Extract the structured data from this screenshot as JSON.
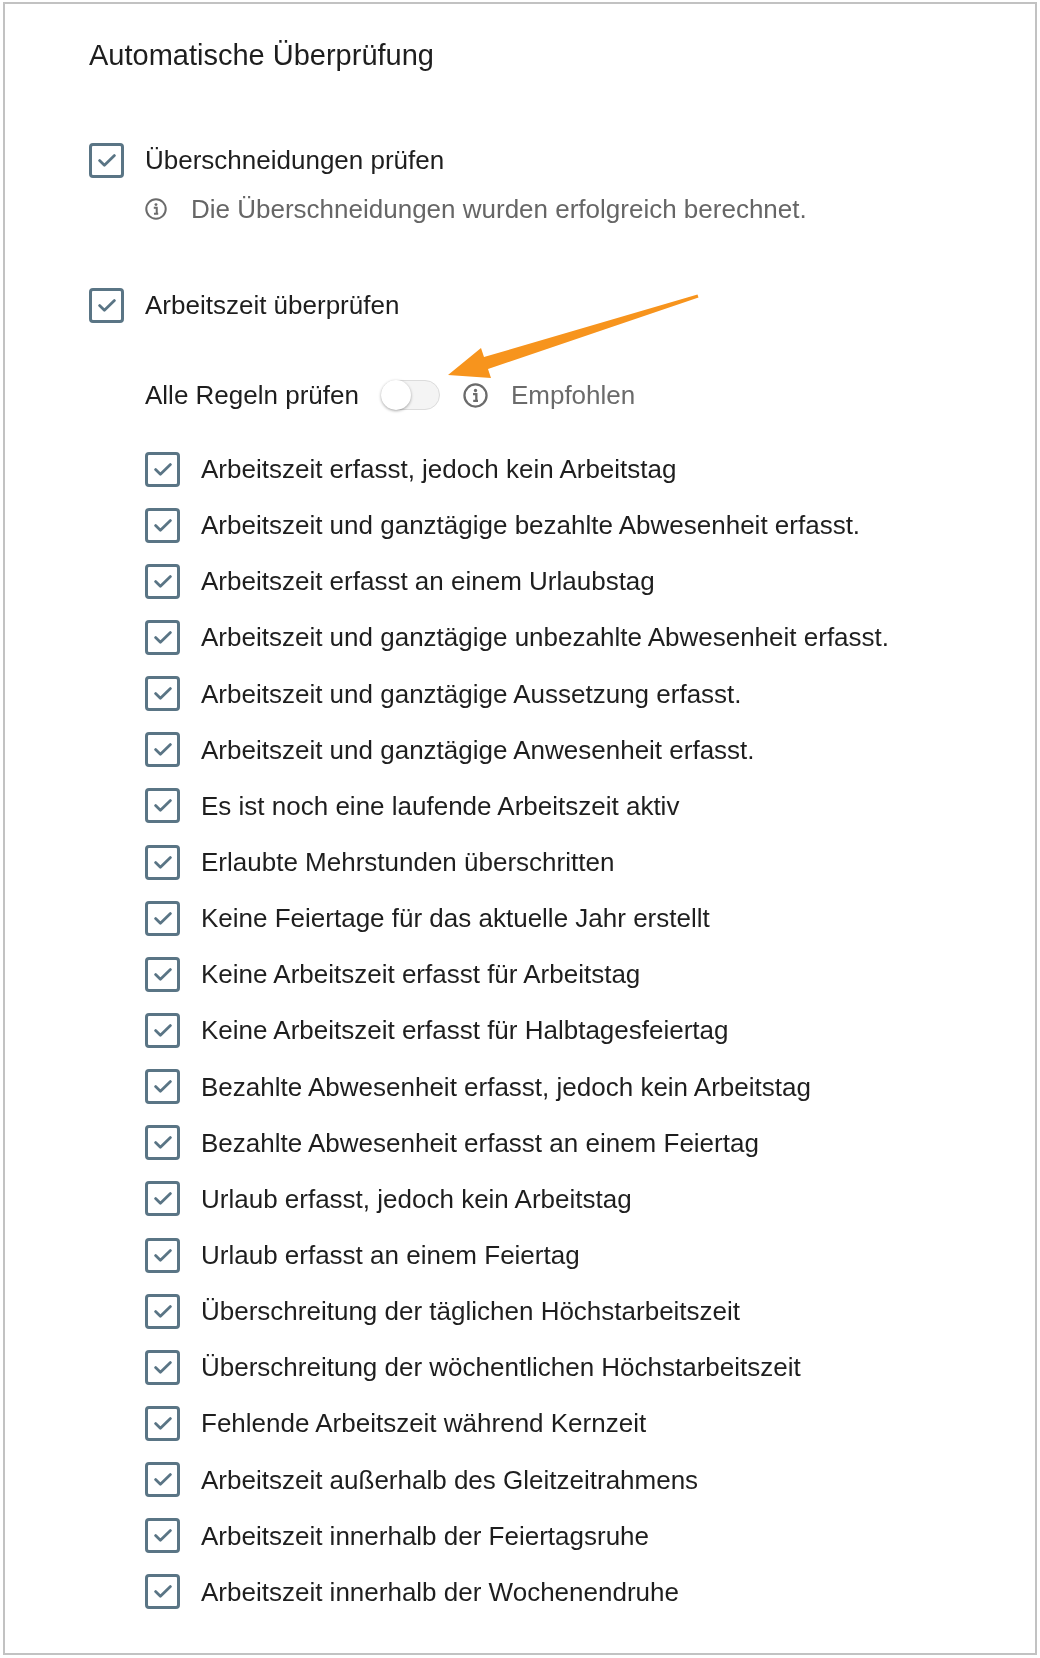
{
  "title": "Automatische Überprüfung",
  "checks": [
    {
      "label": "Überschneidungen prüfen",
      "checked": true,
      "info": "Die Überschneidungen wurden erfolgreich berechnet."
    },
    {
      "label": "Arbeitszeit überprüfen",
      "checked": true,
      "toggle": {
        "label": "Alle Regeln prüfen",
        "on": false,
        "hint": "Empfohlen"
      },
      "rules": [
        {
          "label": "Arbeitszeit erfasst, jedoch kein Arbeitstag",
          "checked": true
        },
        {
          "label": "Arbeitszeit und ganztägige bezahlte Abwesenheit erfasst.",
          "checked": true
        },
        {
          "label": "Arbeitszeit erfasst an einem Urlaubstag",
          "checked": true
        },
        {
          "label": "Arbeitszeit und ganztägige unbezahlte Abwesenheit erfasst.",
          "checked": true
        },
        {
          "label": "Arbeitszeit und ganztägige Aussetzung erfasst.",
          "checked": true
        },
        {
          "label": "Arbeitszeit und ganztägige Anwesenheit erfasst.",
          "checked": true
        },
        {
          "label": "Es ist noch eine laufende Arbeitszeit aktiv",
          "checked": true
        },
        {
          "label": "Erlaubte Mehrstunden überschritten",
          "checked": true
        },
        {
          "label": "Keine Feiertage für das aktuelle Jahr erstellt",
          "checked": true
        },
        {
          "label": "Keine Arbeitszeit erfasst für Arbeitstag",
          "checked": true
        },
        {
          "label": "Keine Arbeitszeit erfasst für Halbtagesfeiertag",
          "checked": true
        },
        {
          "label": "Bezahlte Abwesenheit erfasst, jedoch kein Arbeitstag",
          "checked": true
        },
        {
          "label": "Bezahlte Abwesenheit erfasst an einem Feiertag",
          "checked": true
        },
        {
          "label": "Urlaub erfasst, jedoch kein Arbeitstag",
          "checked": true
        },
        {
          "label": "Urlaub erfasst an einem Feiertag",
          "checked": true
        },
        {
          "label": "Überschreitung der täglichen Höchstarbeitszeit",
          "checked": true
        },
        {
          "label": "Überschreitung der wöchentlichen Höchstarbeitszeit",
          "checked": true
        },
        {
          "label": "Fehlende Arbeitszeit während Kernzeit",
          "checked": true
        },
        {
          "label": "Arbeitszeit außerhalb des Gleitzeitrahmens",
          "checked": true
        },
        {
          "label": "Arbeitszeit innerhalb der Feiertagsruhe",
          "checked": true
        },
        {
          "label": "Arbeitszeit innerhalb der Wochenendruhe",
          "checked": true
        }
      ]
    }
  ]
}
